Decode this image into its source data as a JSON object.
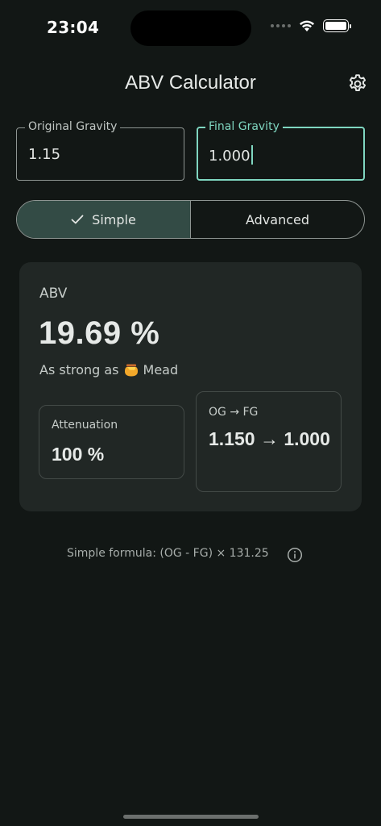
{
  "status": {
    "time": "23:04"
  },
  "header": {
    "title": "ABV Calculator"
  },
  "inputs": {
    "original_gravity": {
      "label": "Original Gravity",
      "value": "1.15"
    },
    "final_gravity": {
      "label": "Final Gravity",
      "value": "1.000"
    }
  },
  "mode": {
    "options": [
      "Simple",
      "Advanced"
    ],
    "selected": "Simple"
  },
  "result": {
    "abv_label": "ABV",
    "abv_value": "19.69 %",
    "strength_prefix": "As strong as",
    "strength_item": "Mead",
    "strength_icon": "honey-pot-icon",
    "attenuation_label": "Attenuation",
    "attenuation_value": "100 %",
    "og_fg_label": "OG → FG",
    "og_fg_value": "1.150 → 1.000"
  },
  "footer": {
    "formula": "Simple formula: (OG - FG) × 131.25"
  },
  "colors": {
    "accent": "#7fd6c0",
    "background": "#121715",
    "card": "#212725",
    "segment_active": "#334b45"
  }
}
